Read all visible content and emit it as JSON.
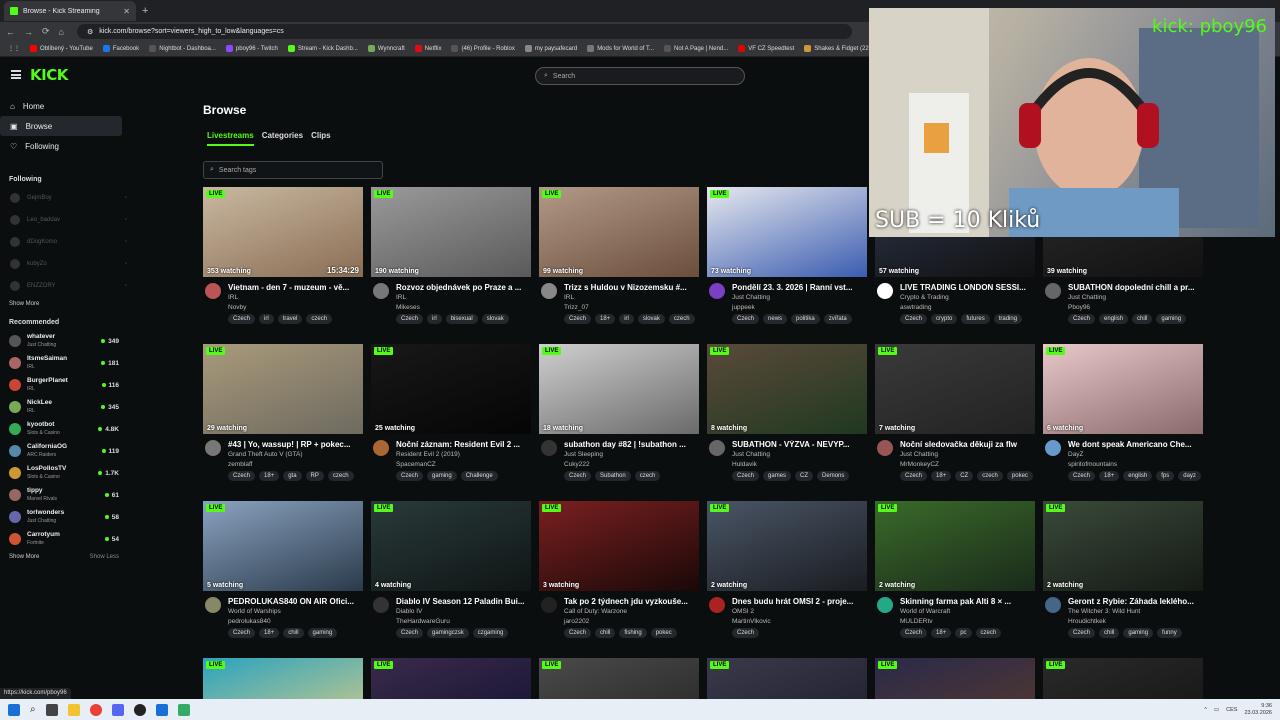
{
  "browser": {
    "tab_title": "Browse - Kick Streaming",
    "url": "kick.com/browse?sort=viewers_high_to_low&languages=cs",
    "bookmarks": [
      "Oblíbený - YouTube",
      "Facebook",
      "Nightbot - Dashboa...",
      "pboy96 - Twitch",
      "Stream - Kick Dashb...",
      "Wynncraft",
      "Netflix",
      "(46) Profile - Roblox",
      "my paysafecard",
      "Mods for World of T...",
      "Not A Page | Nend...",
      "VF CZ Speedtest",
      "Shakes & Fidget (22..."
    ],
    "status_url": "https://kick.com/pboy96"
  },
  "header": {
    "logo": "KICK",
    "search_placeholder": "Search"
  },
  "sidebar": {
    "nav": [
      {
        "label": "Home",
        "icon": "home-icon"
      },
      {
        "label": "Browse",
        "icon": "browse-icon"
      },
      {
        "label": "Following",
        "icon": "heart-icon"
      }
    ],
    "following_title": "Following",
    "following": [
      "GejmBoy",
      "Leo_baddav",
      "dDogKomo",
      "kubyZo",
      "ENZZORY"
    ],
    "show_more": "Show More",
    "recommended_title": "Recommended",
    "recommended": [
      {
        "name": "whatever",
        "cat": "Just Chatting",
        "count": "349",
        "color": "#555"
      },
      {
        "name": "ItsmeSaiman",
        "cat": "IRL",
        "count": "181",
        "color": "#a66"
      },
      {
        "name": "BurgerPlanet",
        "cat": "IRL",
        "count": "116",
        "color": "#c43"
      },
      {
        "name": "NickLee",
        "cat": "IRL",
        "count": "345",
        "color": "#7a5"
      },
      {
        "name": "kyootbot",
        "cat": "Slots & Casino",
        "count": "4.8K",
        "color": "#3a5"
      },
      {
        "name": "CaliforniaOG",
        "cat": "ARC Raiders",
        "count": "119",
        "color": "#58a"
      },
      {
        "name": "LosPollosTV",
        "cat": "Slots & Casino",
        "count": "1.7K",
        "color": "#c93"
      },
      {
        "name": "tippy",
        "cat": "Marvel Rivals",
        "count": "61",
        "color": "#966"
      },
      {
        "name": "torlwonders",
        "cat": "Just Chatting",
        "count": "58",
        "color": "#66a"
      },
      {
        "name": "Carrotyum",
        "cat": "Fortnite",
        "count": "54",
        "color": "#c53"
      }
    ],
    "show_less": "Show Less"
  },
  "main": {
    "title": "Browse",
    "tabs": [
      "Livestreams",
      "Categories",
      "Clips"
    ],
    "tag_search_placeholder": "Search tags",
    "live_label": "LIVE"
  },
  "cards": [
    {
      "title": "Vietnam - den 7 - muzeum - vě...",
      "cat": "IRL",
      "user": "Novby",
      "views": "353 watching",
      "dur": "15:34:29",
      "tags": [
        "Czech",
        "irl",
        "travel",
        "czech"
      ],
      "bg": "#c9b8a0",
      "bg2": "#8a6e55",
      "av": "#b55"
    },
    {
      "title": "Rozvoz objednávek po Praze a ...",
      "cat": "IRL",
      "user": "Mikeses",
      "views": "190 watching",
      "dur": "",
      "tags": [
        "Czech",
        "irl",
        "bisexual",
        "slovak"
      ],
      "bg": "#9a9a9a",
      "bg2": "#5a5a5a",
      "av": "#777"
    },
    {
      "title": "Trizz s Huldou v Nizozemsku #...",
      "cat": "IRL",
      "user": "Trizz_07",
      "views": "99 watching",
      "dur": "",
      "tags": [
        "Czech",
        "18+",
        "irl",
        "slovak",
        "czech"
      ],
      "bg": "#b29a88",
      "bg2": "#6b4e3b",
      "av": "#888"
    },
    {
      "title": "Pondělí 23. 3. 2026 | Ranní vst...",
      "cat": "Just Chatting",
      "user": "juppeek",
      "views": "73 watching",
      "dur": "",
      "tags": [
        "Czech",
        "news",
        "politika",
        "zvířata"
      ],
      "bg": "#e6e8ee",
      "bg2": "#3b5cb0",
      "av": "#7a3fc4"
    },
    {
      "title": "LIVE TRADING LONDON SESSI...",
      "cat": "Crypto & Trading",
      "user": "aswtrading",
      "views": "57 watching",
      "dur": "",
      "tags": [
        "Czech",
        "crypto",
        "futures",
        "trading"
      ],
      "bg": "#2b3448",
      "bg2": "#111",
      "av": "#fff"
    },
    {
      "title": "SUBATHON dopolední chill a pr...",
      "cat": "Just Chatting",
      "user": "Pboy96",
      "views": "39 watching",
      "dur": "",
      "tags": [
        "Czech",
        "english",
        "chill",
        "gaming"
      ],
      "bg": "#2a2a2a",
      "bg2": "#111",
      "av": "#666"
    },
    {
      "title": "#43 | Yo, wassup! | RP + pokec...",
      "cat": "Grand Theft Auto V (GTA)",
      "user": "zemblaff",
      "views": "29 watching",
      "dur": "",
      "tags": [
        "Czech",
        "18+",
        "gta",
        "RP",
        "czech"
      ],
      "bg": "#a99a7a",
      "bg2": "#6e6a60",
      "av": "#777"
    },
    {
      "title": "Noční záznam: Resident Evil 2 ...",
      "cat": "Resident Evil 2 (2019)",
      "user": "SpacemanCZ",
      "views": "25 watching",
      "dur": "",
      "tags": [
        "Czech",
        "gaming",
        "Challenge"
      ],
      "bg": "#181818",
      "bg2": "#050505",
      "av": "#a63"
    },
    {
      "title": "subathon day #82 | !subathon ...",
      "cat": "Just Sleeping",
      "user": "Cuky222",
      "views": "18 watching",
      "dur": "",
      "tags": [
        "Czech",
        "Subathon",
        "czech"
      ],
      "bg": "#cfcfcf",
      "bg2": "#6a6a6a",
      "av": "#333"
    },
    {
      "title": "SUBATHON - VÝZVA - NEVYP...",
      "cat": "Just Chatting",
      "user": "Huldavik",
      "views": "8 watching",
      "dur": "",
      "tags": [
        "Czech",
        "games",
        "CZ",
        "Demons"
      ],
      "bg": "#5a4a3a",
      "bg2": "#203820",
      "av": "#666"
    },
    {
      "title": "Noční sledovačka děkuji za flw",
      "cat": "Just Chatting",
      "user": "MrMonkeyCZ",
      "views": "7 watching",
      "dur": "",
      "tags": [
        "Czech",
        "18+",
        "CZ",
        "czech",
        "pokec"
      ],
      "bg": "#3a3a3a",
      "bg2": "#222",
      "av": "#955"
    },
    {
      "title": "We dont speak Americano Che...",
      "cat": "DayZ",
      "user": "spiritofmountains",
      "views": "6 watching",
      "dur": "",
      "tags": [
        "Czech",
        "18+",
        "english",
        "fps",
        "dayz"
      ],
      "bg": "#e8c8c8",
      "bg2": "#8a6a6a",
      "av": "#69c"
    },
    {
      "title": "PEDROLUKAS840 ON AIR Ofici...",
      "cat": "World of Warships",
      "user": "pedrolukas840",
      "views": "5 watching",
      "dur": "",
      "tags": [
        "Czech",
        "18+",
        "chill",
        "gaming"
      ],
      "bg": "#8aa3c0",
      "bg2": "#2a3a4a",
      "av": "#886"
    },
    {
      "title": "Diablo IV Season 12 Paladin Bui...",
      "cat": "Diablo IV",
      "user": "TheHardwareGuru",
      "views": "4 watching",
      "dur": "",
      "tags": [
        "Czech",
        "gamingczsk",
        "czgaming"
      ],
      "bg": "#2a3a3a",
      "bg2": "#0f1515",
      "av": "#333"
    },
    {
      "title": "Tak po 2 týdnech jdu vyzkouše...",
      "cat": "Call of Duty: Warzone",
      "user": "jaro2202",
      "views": "3 watching",
      "dur": "",
      "tags": [
        "Czech",
        "chill",
        "fishing",
        "pokec"
      ],
      "bg": "#7a2020",
      "bg2": "#1a0808",
      "av": "#222"
    },
    {
      "title": "Dnes budu hrát OMSI 2 - proje...",
      "cat": "OMSI 2",
      "user": "MartinVlkovic",
      "views": "2 watching",
      "dur": "",
      "tags": [
        "Czech"
      ],
      "bg": "#4a5565",
      "bg2": "#1a1d22",
      "av": "#a22"
    },
    {
      "title": "Skinning farma pak Alti 8 × ...",
      "cat": "World of Warcraft",
      "user": "MULDERtv",
      "views": "2 watching",
      "dur": "",
      "tags": [
        "Czech",
        "18+",
        "pc",
        "czech"
      ],
      "bg": "#3a6a2a",
      "bg2": "#1a2a1a",
      "av": "#2a8"
    },
    {
      "title": "Geront z Rybie: Záhada leklého...",
      "cat": "The Witcher 3: Wild Hunt",
      "user": "Hroudichtkek",
      "views": "2 watching",
      "dur": "",
      "tags": [
        "Czech",
        "chill",
        "gaming",
        "funny"
      ],
      "bg": "#3a4a3a",
      "bg2": "#151a15",
      "av": "#468"
    },
    {
      "title": "",
      "cat": "",
      "user": "",
      "views": "",
      "dur": "",
      "tags": [],
      "bg": "#2aa3c0",
      "bg2": "#e8d080",
      "av": "#333"
    },
    {
      "title": "",
      "cat": "",
      "user": "",
      "views": "",
      "dur": "",
      "tags": [],
      "bg": "#3a2a4a",
      "bg2": "#101030",
      "av": "#333"
    },
    {
      "title": "",
      "cat": "",
      "user": "",
      "views": "",
      "dur": "",
      "tags": [],
      "bg": "#4a4a4a",
      "bg2": "#222",
      "av": "#333"
    },
    {
      "title": "",
      "cat": "",
      "user": "",
      "views": "",
      "dur": "",
      "tags": [],
      "bg": "#3a3a4a",
      "bg2": "#1a1a2a",
      "av": "#333"
    },
    {
      "title": "",
      "cat": "",
      "user": "",
      "views": "",
      "dur": "",
      "tags": [],
      "bg": "#2a2a4a",
      "bg2": "#5a3a2a",
      "av": "#333"
    },
    {
      "title": "",
      "cat": "",
      "user": "",
      "views": "",
      "dur": "",
      "tags": [],
      "bg": "#2a2a2a",
      "bg2": "#111",
      "av": "#333"
    }
  ],
  "overlay": {
    "kick_name": "kick: pboy96",
    "sub_text": "SUB = 10 Kliků"
  },
  "taskbar": {
    "tray_lang": "CES",
    "time": "9:36",
    "date": "23.03.2026"
  }
}
